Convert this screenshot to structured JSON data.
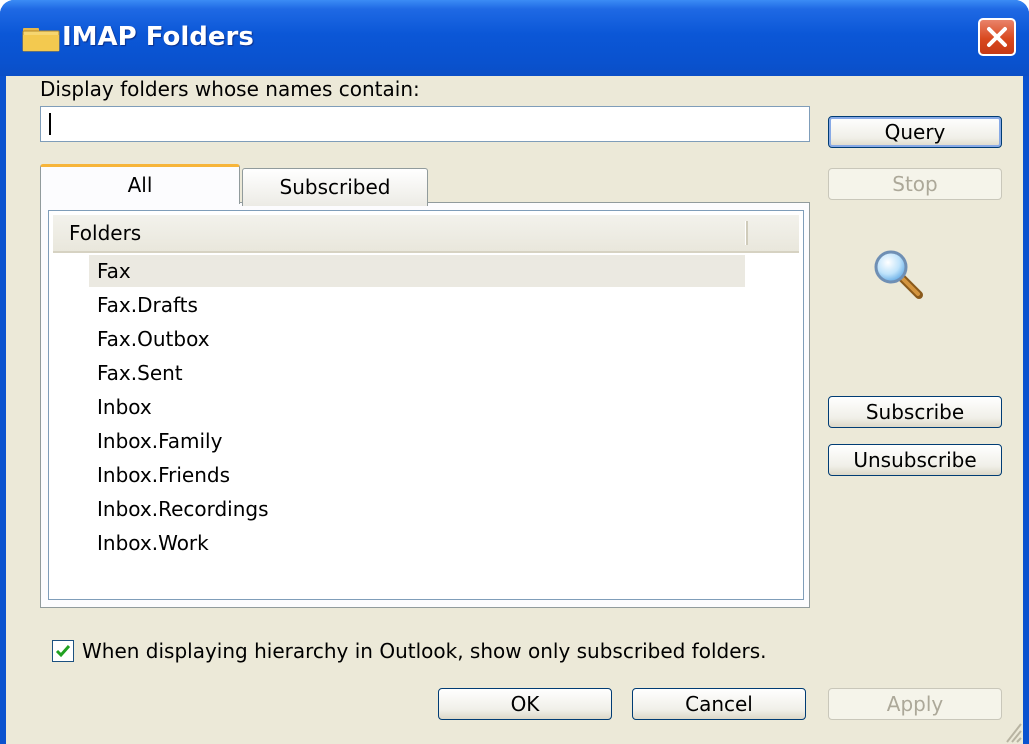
{
  "window": {
    "title": "IMAP Folders"
  },
  "filter": {
    "label": "Display folders whose names contain:",
    "value": ""
  },
  "buttons": {
    "query": "Query",
    "stop": "Stop",
    "subscribe": "Subscribe",
    "unsubscribe": "Unsubscribe",
    "ok": "OK",
    "cancel": "Cancel",
    "apply": "Apply"
  },
  "tabs": [
    {
      "label": "All",
      "active": true
    },
    {
      "label": "Subscribed",
      "active": false
    }
  ],
  "folder_list": {
    "header": "Folders",
    "items": [
      {
        "name": "Fax",
        "selected": true
      },
      {
        "name": "Fax.Drafts",
        "selected": false
      },
      {
        "name": "Fax.Outbox",
        "selected": false
      },
      {
        "name": "Fax.Sent",
        "selected": false
      },
      {
        "name": "Inbox",
        "selected": false
      },
      {
        "name": "Inbox.Family",
        "selected": false
      },
      {
        "name": "Inbox.Friends",
        "selected": false
      },
      {
        "name": "Inbox.Recordings",
        "selected": false
      },
      {
        "name": "Inbox.Work",
        "selected": false
      }
    ]
  },
  "option": {
    "checked": true,
    "label": "When displaying hierarchy in Outlook, show only subscribed folders."
  },
  "icons": {
    "title": "folder-icon",
    "close": "close-icon",
    "search": "magnifier-icon"
  },
  "colors": {
    "titlebar": "#0a52cf",
    "face": "#ece9d8",
    "close": "#d9491f",
    "tab_highlight": "#f7b53a",
    "check": "#21a121"
  }
}
